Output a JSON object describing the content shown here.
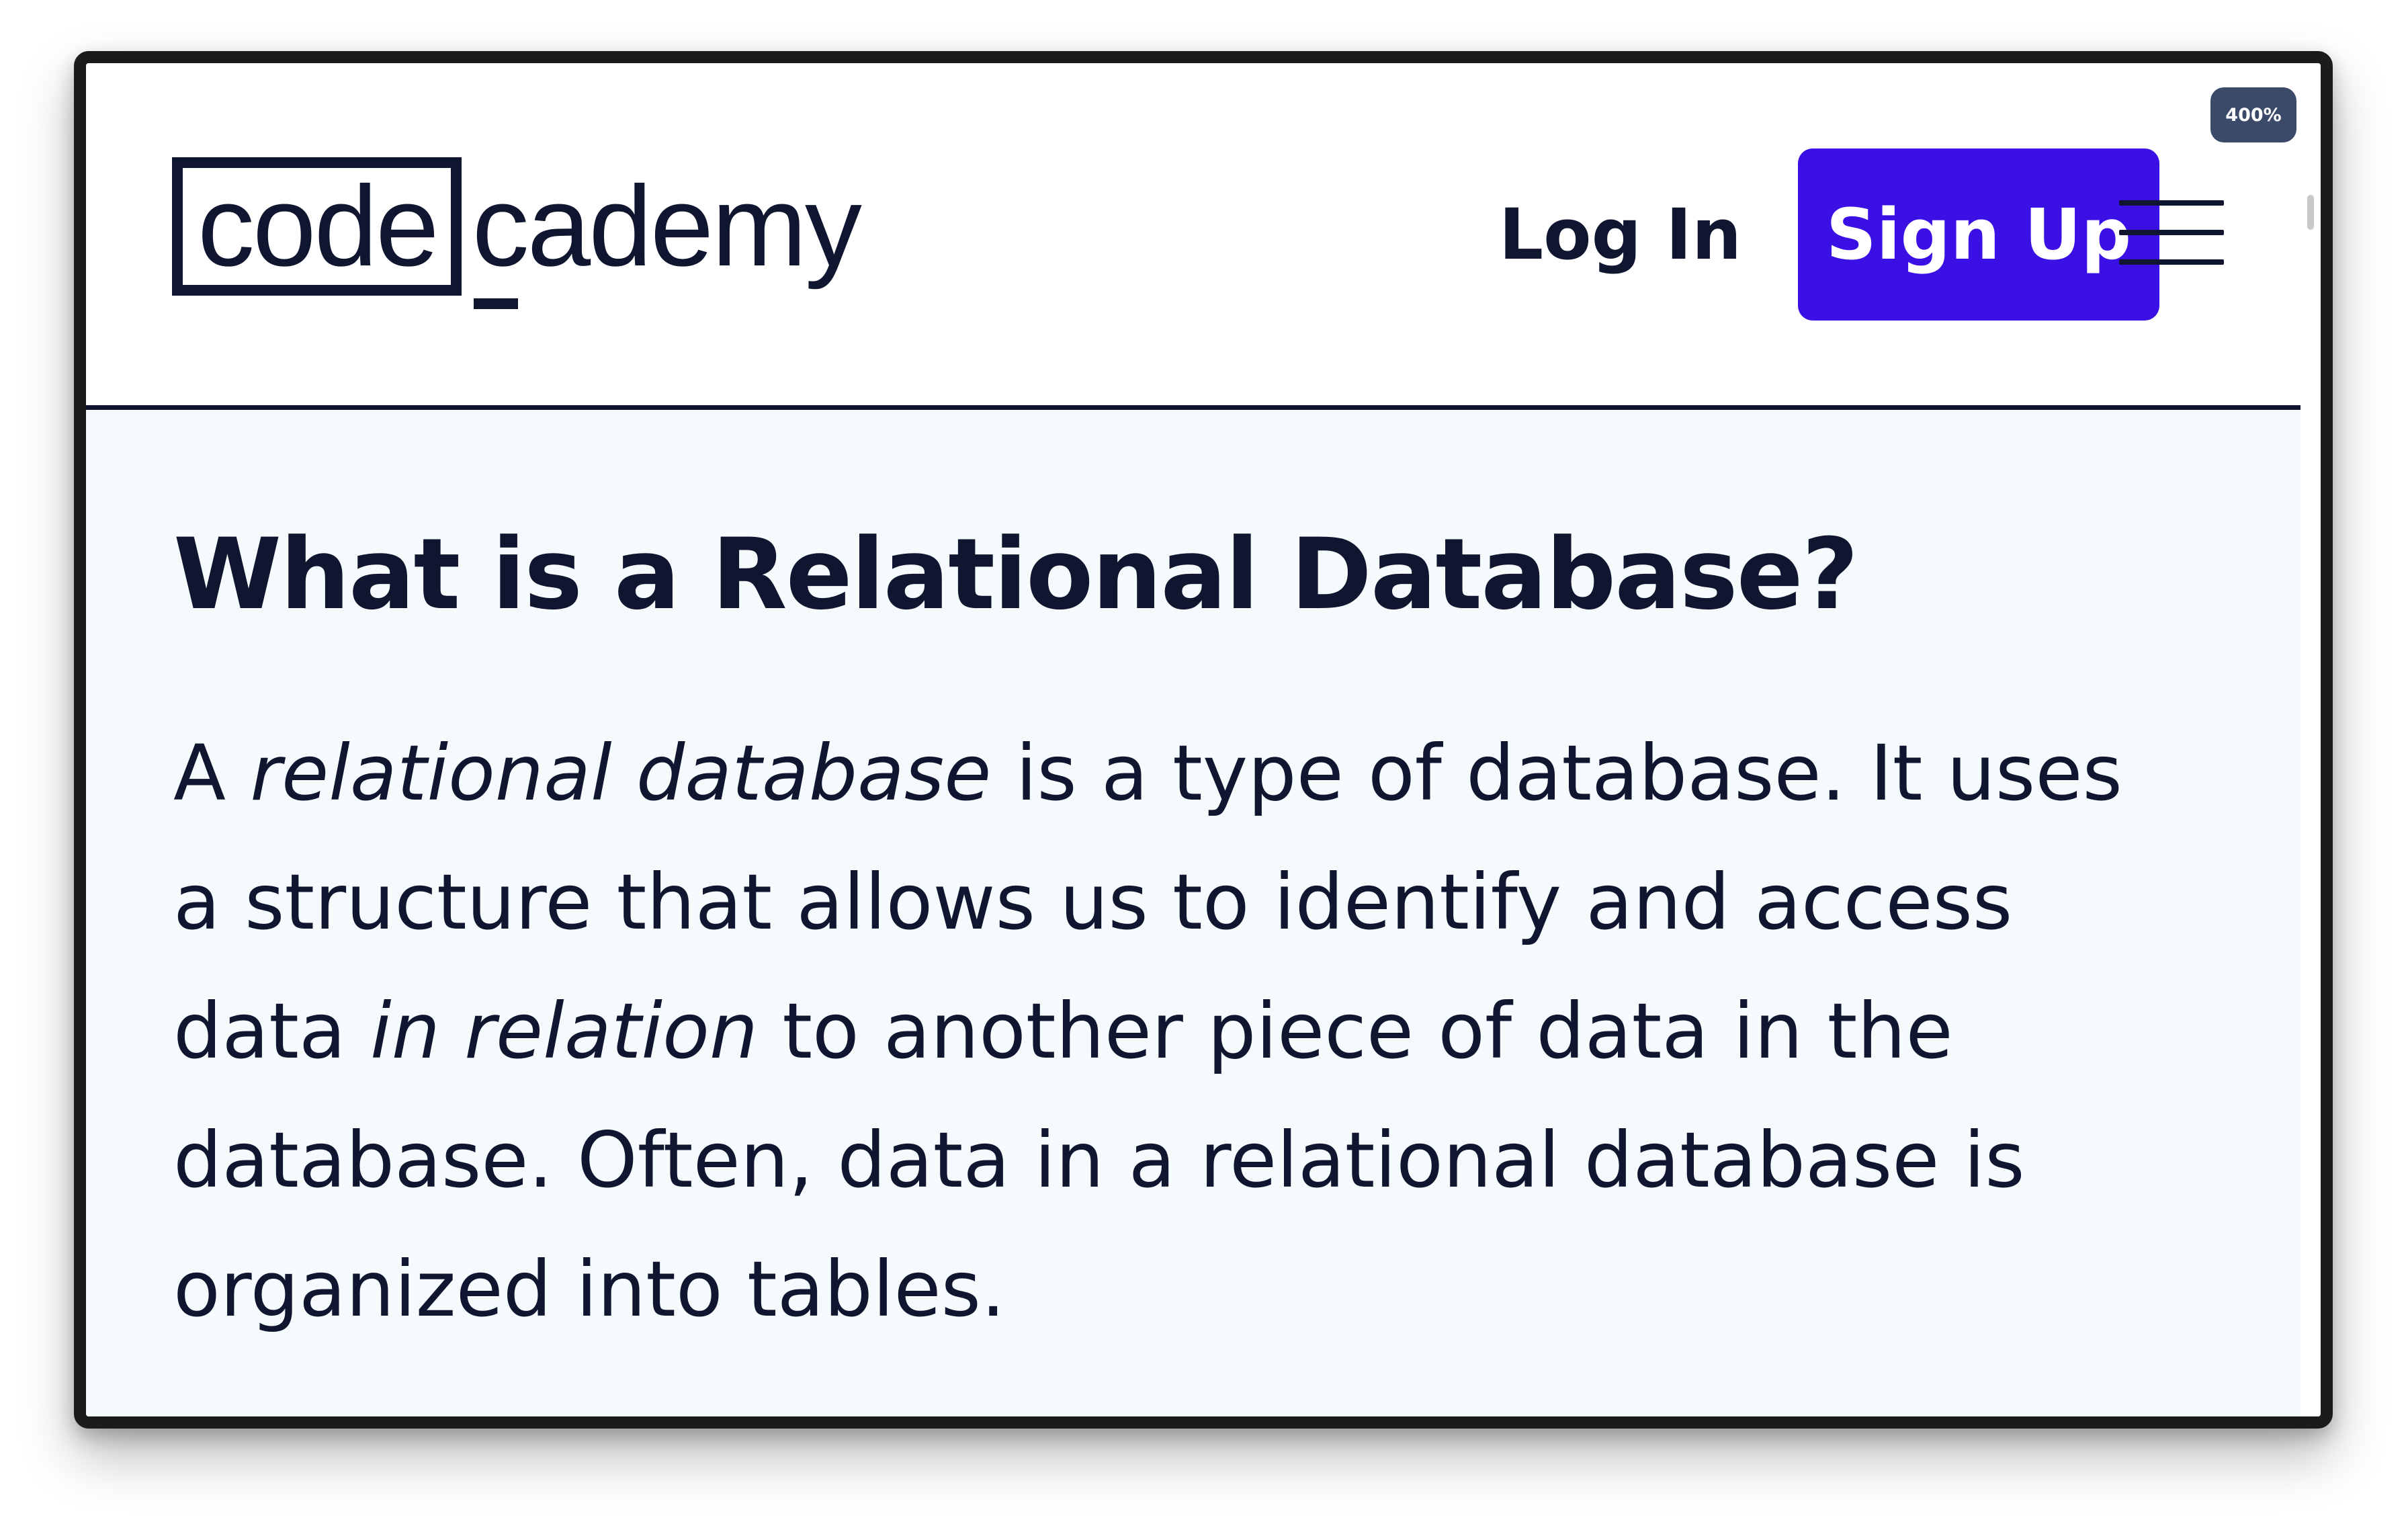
{
  "browser": {
    "zoom_label": "400%"
  },
  "header": {
    "logo": {
      "boxed_text": "code",
      "rest_text": "cademy"
    },
    "login_label": "Log In",
    "signup_label": "Sign Up",
    "menu_icon": "hamburger-menu-icon"
  },
  "article": {
    "title": "What is a Relational Database?",
    "paragraph": {
      "t1": "A ",
      "em1": "relational database",
      "t2": " is a type of database. It uses a structure that allows us to identify and access data ",
      "em2": "in relation",
      "t3": " to another piece of data in the database. Often, data in a relational database is organized into tables."
    }
  },
  "colors": {
    "brand_navy": "#10162f",
    "signup_blue": "#3a10e5",
    "content_bg": "#f5fafd",
    "badge_bg": "#3b4a68"
  }
}
